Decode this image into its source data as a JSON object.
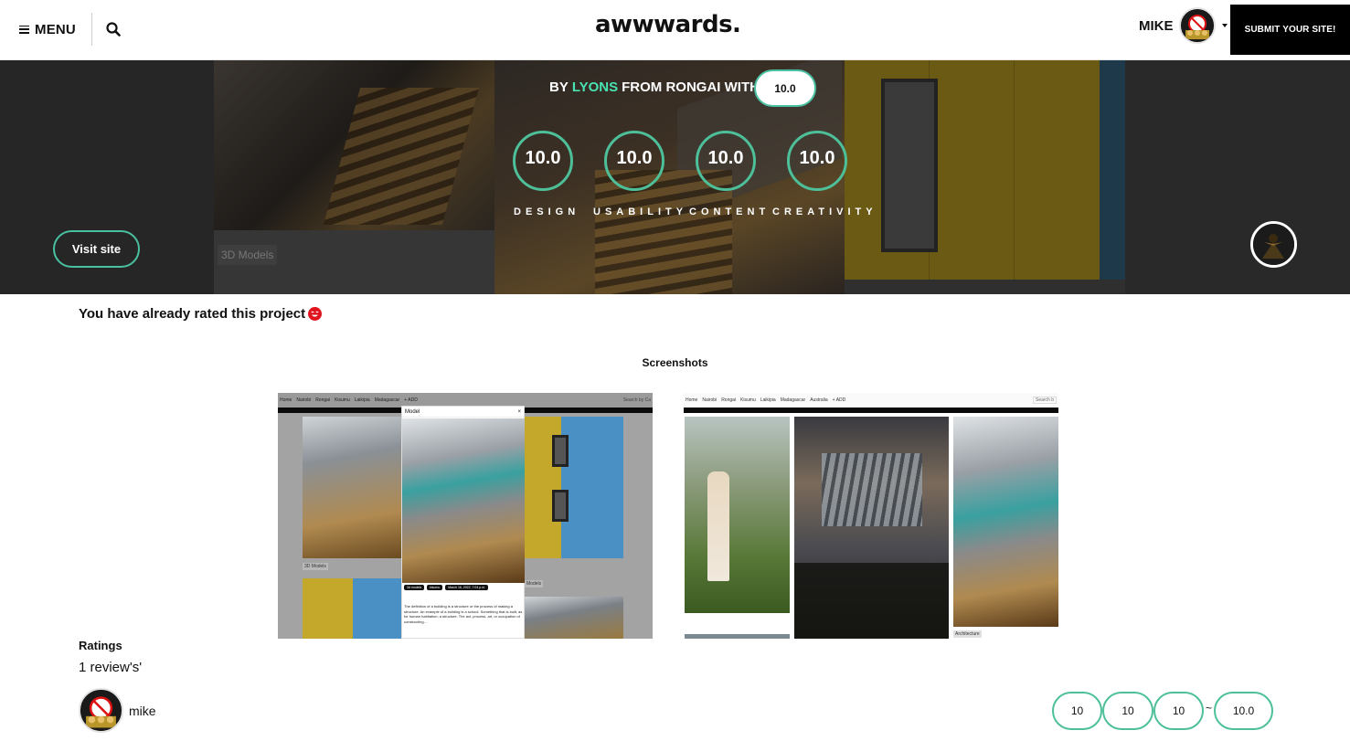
{
  "header": {
    "menu_label": "MENU",
    "logo": "awwwards.",
    "user_name": "MIKE",
    "submit_label": "SUBMIT YOUR SITE!"
  },
  "hero": {
    "by_prefix": "BY",
    "author": "LYONS",
    "from_text": "FROM RONGAI WITH",
    "overall_score": "10.0",
    "scores": [
      {
        "label": "DESIGN",
        "value": "10.0"
      },
      {
        "label": "USABILITY",
        "value": "10.0"
      },
      {
        "label": "CONTENT",
        "value": "10.0"
      },
      {
        "label": "CREATIVITY",
        "value": "10.0"
      }
    ],
    "visit_label": "Visit site",
    "bg_tag": "3D Models"
  },
  "rated_message": "You have already rated this project",
  "screenshots": {
    "title": "Screenshots",
    "shot1": {
      "nav": [
        "Home",
        "Nairobi",
        "Rongai",
        "Kisumu",
        "Laikipia",
        "Madagascar",
        "+ ADD"
      ],
      "search_placeholder": "Search by Ca",
      "modal_title": "Model",
      "modal_close": "×",
      "chips": [
        "3d models",
        "kisumu",
        "March 16, 2022, 7:04 p.m."
      ],
      "modal_text": "The definition of a building is a structure or the process of making a structure. An example of a building is a school. Something that is built, as for human habitation; a structure. The act, process, art, or occupation of constructing...",
      "tag": "3D Models",
      "tag2": "Models"
    },
    "shot2": {
      "nav": [
        "Home",
        "Nairobi",
        "Rongai",
        "Kisumu",
        "Laikipia",
        "Madagascar",
        "Australia",
        "+ ADD"
      ],
      "search_placeholder": "Search b",
      "tag": "Architecture"
    }
  },
  "ratings": {
    "title": "Ratings",
    "count_text": "1 review's'",
    "reviewer": "mike",
    "values": [
      "10",
      "10",
      "10"
    ],
    "separator": "~",
    "average": "10.0"
  },
  "colors": {
    "accent": "#49e2b3",
    "ring": "#4dbf99",
    "black": "#000000"
  }
}
